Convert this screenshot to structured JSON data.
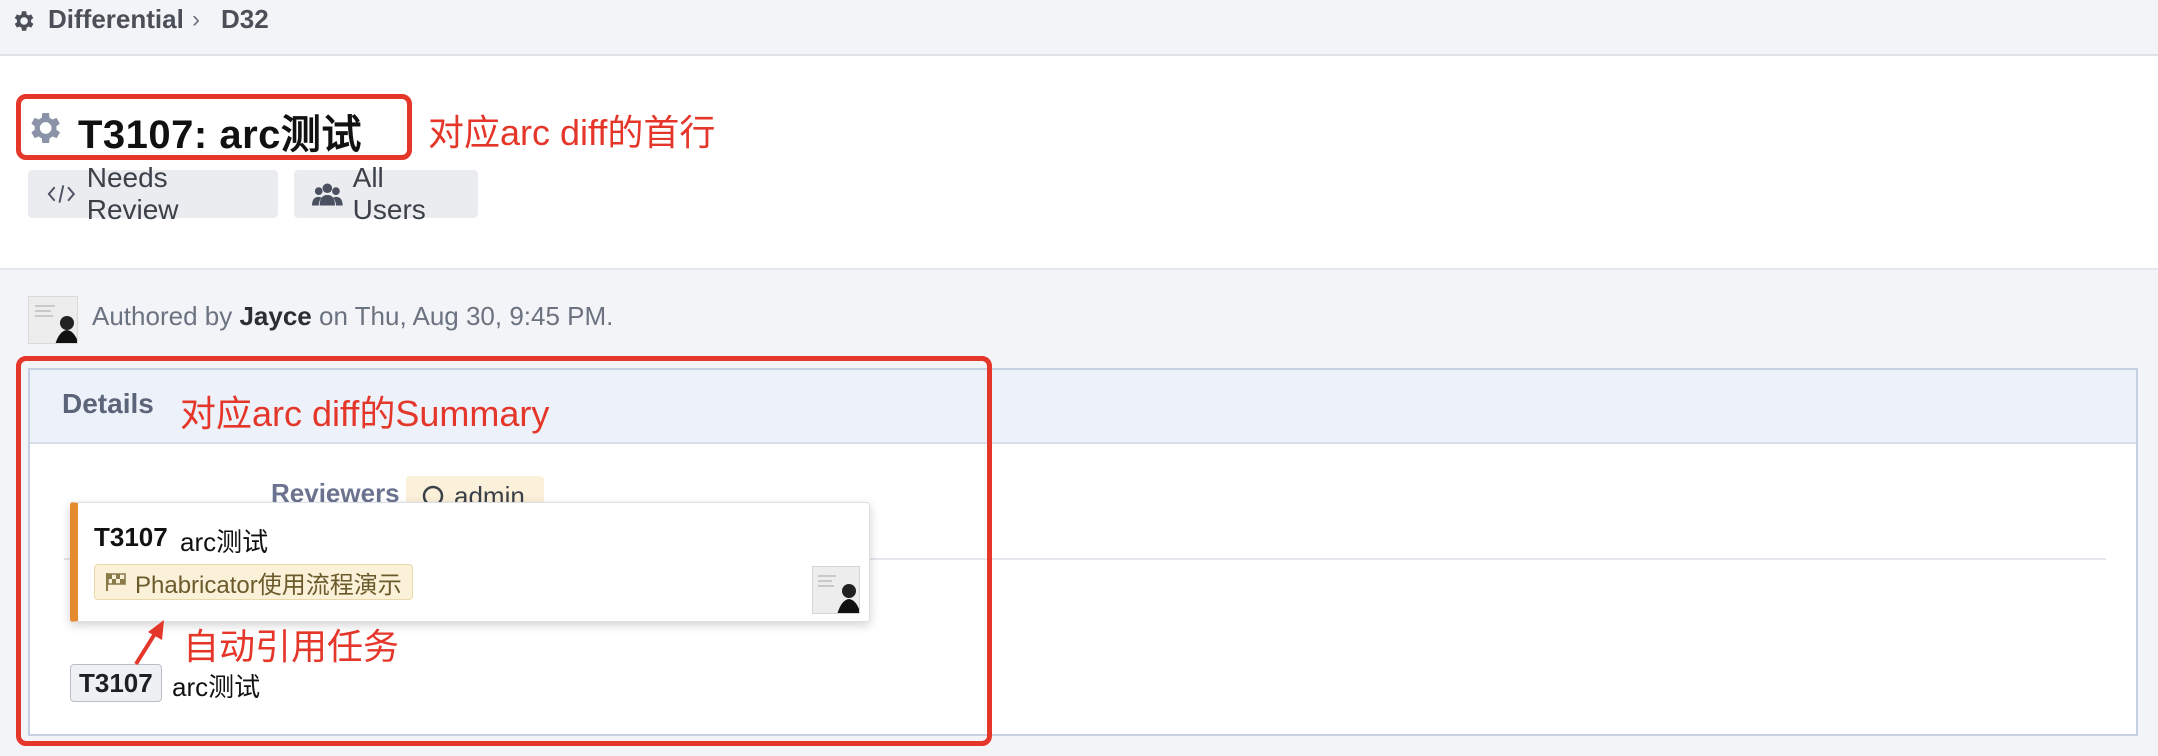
{
  "breadcrumb": {
    "app": "Differential",
    "separator": "›",
    "item": "D32"
  },
  "header": {
    "title": "T3107: arc测试",
    "tags": [
      {
        "icon": "code-icon",
        "label": "Needs Review"
      },
      {
        "icon": "users-icon",
        "label": "All Users"
      }
    ]
  },
  "author": {
    "prefix": "Authored by",
    "name": "Jayce",
    "suffix": "on Thu, Aug 30, 9:45 PM."
  },
  "details": {
    "label": "Details",
    "reviewers_label": "Reviewers",
    "reviewer": "admin"
  },
  "hovercard": {
    "task_id": "T3107",
    "task_name": "arc测试",
    "project": "Phabricator使用流程演示"
  },
  "task_ref": {
    "id": "T3107",
    "name": "arc测试"
  },
  "annotations": {
    "title_note": "对应arc diff的首行",
    "details_note": "对应arc diff的Summary",
    "task_note": "自动引用任务"
  },
  "colors": {
    "annotation": "#e5362a",
    "card_accent": "#e58b2d",
    "panel_header": "#ecf1fa",
    "background": "#f3f4f7"
  }
}
